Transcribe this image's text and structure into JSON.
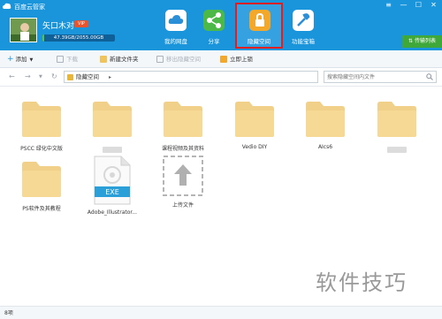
{
  "window": {
    "title": "百度云管家"
  },
  "window_controls": [
    "≡",
    "—",
    "☐",
    "✕"
  ],
  "user": {
    "name": "矢口木对",
    "vip": "VIP",
    "quota_text": "47.39GB/2055.00GB",
    "quota_used_fraction": 0.023
  },
  "nav": [
    {
      "label": "我的网盘",
      "icon": "cloud-icon"
    },
    {
      "label": "分享",
      "icon": "share-icon"
    },
    {
      "label": "隐藏空间",
      "icon": "lock-icon"
    },
    {
      "label": "功能宝箱",
      "icon": "toolbox-icon"
    }
  ],
  "transfer": {
    "label": "传输列表"
  },
  "toolbar": {
    "add": "添加",
    "download": "下载",
    "new_folder": "新建文件夹",
    "move_out": "移出隐藏空间",
    "lock": "立即上锁"
  },
  "addressbar": {
    "path": "隐藏空间",
    "search_placeholder": "搜索隐藏空间内文件"
  },
  "files": [
    {
      "name": "PSCC 绿化中文版",
      "type": "folder"
    },
    {
      "name": "",
      "type": "folder"
    },
    {
      "name": "课程视频及其资料",
      "type": "folder"
    },
    {
      "name": "Vedio DIY",
      "type": "folder"
    },
    {
      "name": "AIcs6",
      "type": "folder"
    },
    {
      "name": "",
      "type": "folder"
    },
    {
      "name": "PS软件及其教程",
      "type": "folder"
    },
    {
      "name": "Adobe_Illustrator...",
      "type": "exe",
      "badge": "EXE"
    },
    {
      "name": "上传文件",
      "type": "upload"
    }
  ],
  "status": {
    "text": "8项"
  },
  "watermark": "软件技巧",
  "colors": {
    "header": "#1a95dc",
    "folder": "#f1d089",
    "active_border": "#e02020"
  }
}
